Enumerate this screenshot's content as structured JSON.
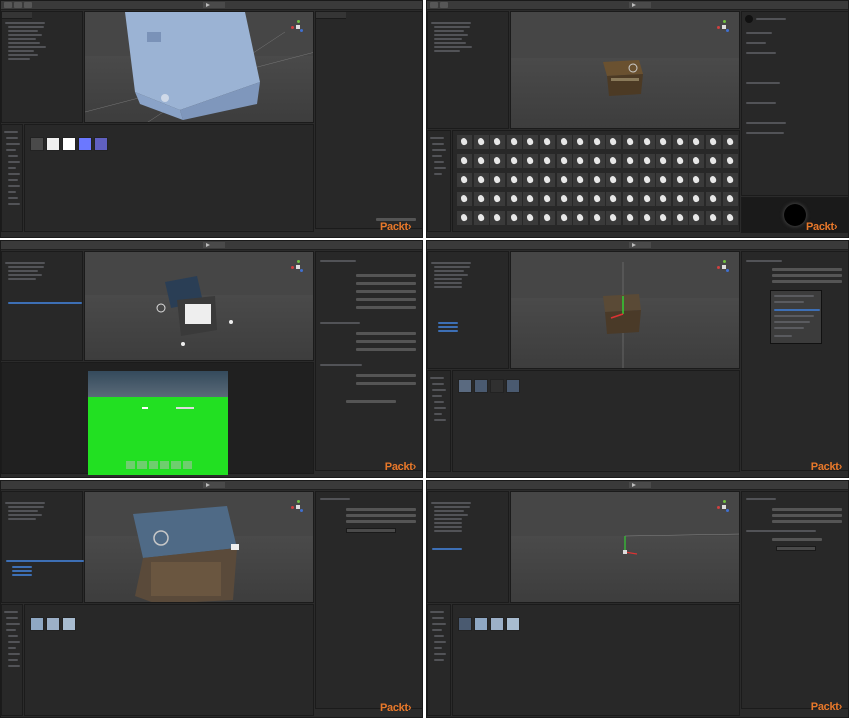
{
  "tutorial": {
    "watermark": "Packt›"
  },
  "frames": [
    {
      "id": 1,
      "subject": "chest-closeup"
    },
    {
      "id": 2,
      "subject": "sprite-grid"
    },
    {
      "id": 3,
      "subject": "open-chest-ui"
    },
    {
      "id": 4,
      "subject": "chest-inspector-menu"
    },
    {
      "id": 5,
      "subject": "chest-metal-closeup"
    },
    {
      "id": 6,
      "subject": "empty-scene"
    }
  ],
  "colors": {
    "accent": "#e8782a",
    "ui_dark": "#2b2b2b",
    "selection": "#3d6fb5",
    "green_screen": "#22e022"
  }
}
